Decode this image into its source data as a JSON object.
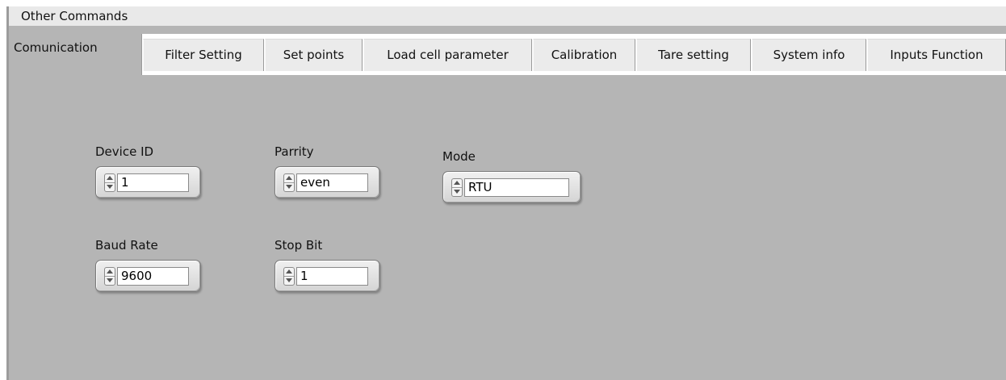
{
  "menu": {
    "other_commands": "Other Commands"
  },
  "tabs": [
    {
      "label": "Comunication",
      "active": true
    },
    {
      "label": "Filter Setting",
      "active": false
    },
    {
      "label": "Set points",
      "active": false
    },
    {
      "label": "Load cell parameter",
      "active": false
    },
    {
      "label": "Calibration",
      "active": false
    },
    {
      "label": "Tare setting",
      "active": false
    },
    {
      "label": "System info",
      "active": false
    },
    {
      "label": "Inputs Function",
      "active": false
    }
  ],
  "controls": {
    "device_id": {
      "label": "Device ID",
      "value": "1"
    },
    "parity": {
      "label": "Parrity",
      "value": "even"
    },
    "mode": {
      "label": "Mode",
      "value": "RTU"
    },
    "baud_rate": {
      "label": "Baud Rate",
      "value": "9600"
    },
    "stop_bit": {
      "label": "Stop Bit",
      "value": "1"
    }
  },
  "colors": {
    "panel_background": "#b5b5b5",
    "inactive_tab": "#ebebeb",
    "menubar": "#e9e9e9"
  }
}
